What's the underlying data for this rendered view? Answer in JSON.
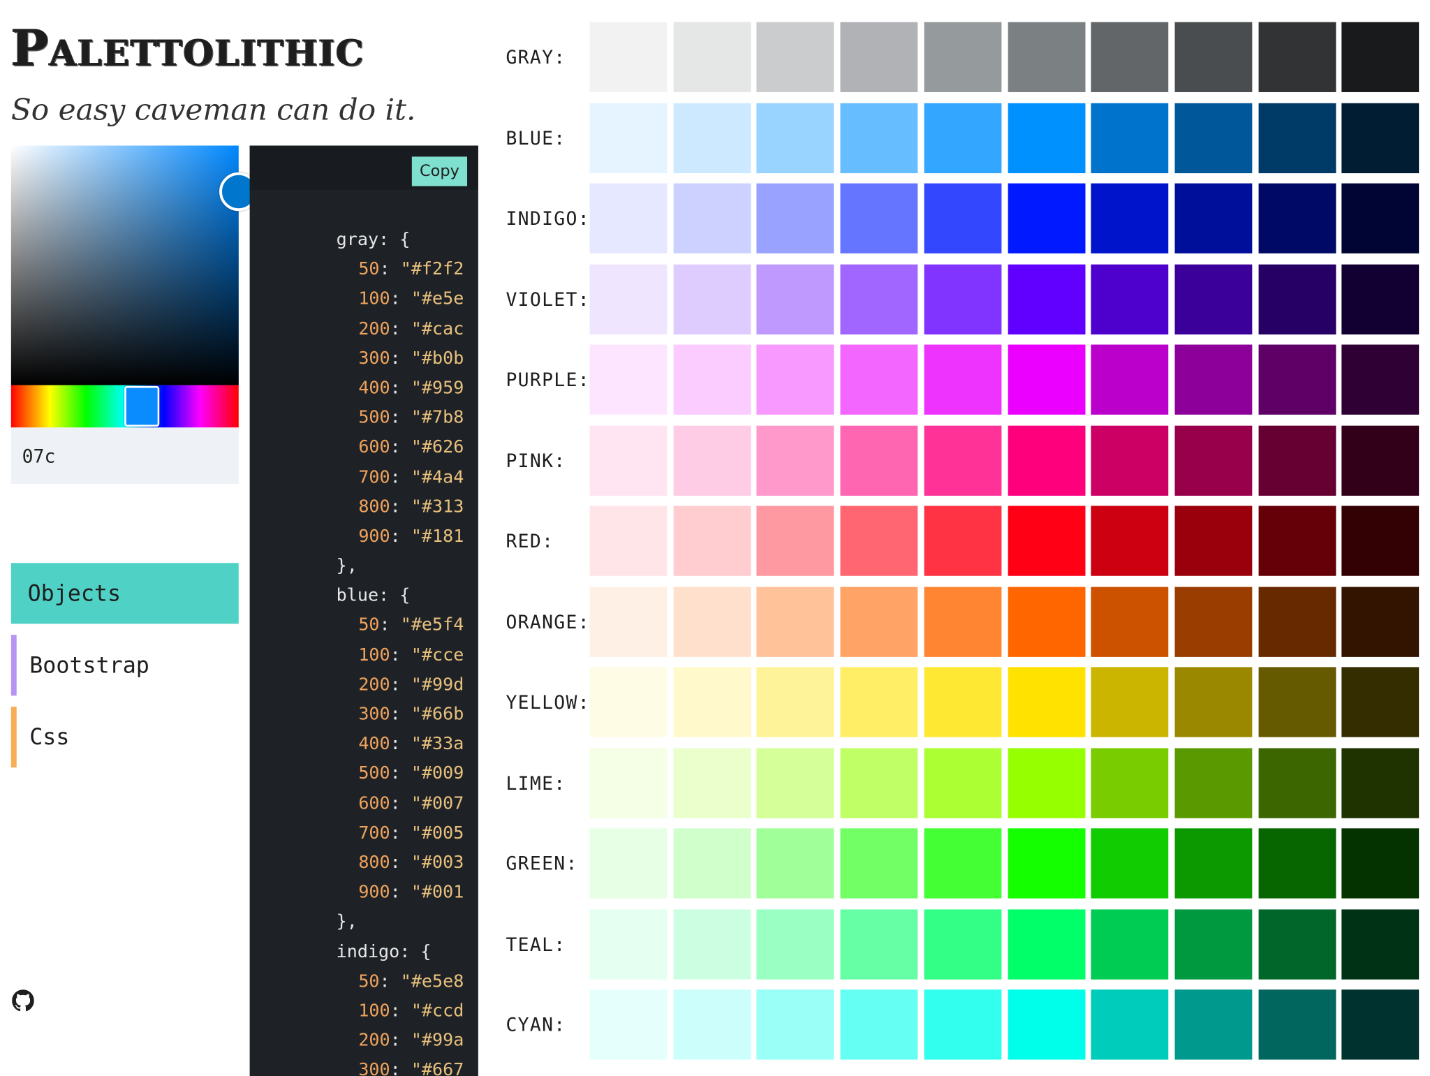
{
  "header": {
    "logo_text": "Palettolithic",
    "tagline": "So easy caveman can do it."
  },
  "picker": {
    "hex_value": "07c",
    "selected_color": "#0077cc",
    "hue_color": "#0088ff"
  },
  "tabs": [
    {
      "label": "Objects",
      "accent": "#4fd1c5",
      "active": true
    },
    {
      "label": "Bootstrap",
      "accent": "#b794f4",
      "active": false
    },
    {
      "label": "Css",
      "accent": "#f6ad55",
      "active": false
    }
  ],
  "code_panel": {
    "copy_label": "Copy",
    "lines": [
      {
        "t": "open",
        "name": "gray"
      },
      {
        "t": "val",
        "k": "50",
        "v": "#f2f2"
      },
      {
        "t": "val",
        "k": "100",
        "v": "#e5e"
      },
      {
        "t": "val",
        "k": "200",
        "v": "#cac"
      },
      {
        "t": "val",
        "k": "300",
        "v": "#b0b"
      },
      {
        "t": "val",
        "k": "400",
        "v": "#959"
      },
      {
        "t": "val",
        "k": "500",
        "v": "#7b8"
      },
      {
        "t": "val",
        "k": "600",
        "v": "#626"
      },
      {
        "t": "val",
        "k": "700",
        "v": "#4a4"
      },
      {
        "t": "val",
        "k": "800",
        "v": "#313"
      },
      {
        "t": "val",
        "k": "900",
        "v": "#181"
      },
      {
        "t": "close"
      },
      {
        "t": "open",
        "name": "blue"
      },
      {
        "t": "val",
        "k": "50",
        "v": "#e5f4"
      },
      {
        "t": "val",
        "k": "100",
        "v": "#cce"
      },
      {
        "t": "val",
        "k": "200",
        "v": "#99d"
      },
      {
        "t": "val",
        "k": "300",
        "v": "#66b"
      },
      {
        "t": "val",
        "k": "400",
        "v": "#33a"
      },
      {
        "t": "val",
        "k": "500",
        "v": "#009"
      },
      {
        "t": "val",
        "k": "600",
        "v": "#007"
      },
      {
        "t": "val",
        "k": "700",
        "v": "#005"
      },
      {
        "t": "val",
        "k": "800",
        "v": "#003"
      },
      {
        "t": "val",
        "k": "900",
        "v": "#001"
      },
      {
        "t": "close"
      },
      {
        "t": "open",
        "name": "indigo"
      },
      {
        "t": "val",
        "k": "50",
        "v": "#e5e8"
      },
      {
        "t": "val",
        "k": "100",
        "v": "#ccd"
      },
      {
        "t": "val",
        "k": "200",
        "v": "#99a"
      },
      {
        "t": "val",
        "k": "300",
        "v": "#667"
      }
    ]
  },
  "palette": [
    {
      "label": "GRAY:",
      "swatches": [
        "#f2f2f2",
        "#e5e6e6",
        "#cacccd",
        "#b0b2b5",
        "#959a9c",
        "#7b8083",
        "#626669",
        "#4a4d4f",
        "#313334",
        "#181a1b"
      ]
    },
    {
      "label": "BLUE:",
      "swatches": [
        "#e5f4ff",
        "#cce9ff",
        "#99d3ff",
        "#66bdff",
        "#33a7ff",
        "#0091ff",
        "#0074cc",
        "#005799",
        "#003a66",
        "#001d33"
      ]
    },
    {
      "label": "INDIGO:",
      "swatches": [
        "#e5e8ff",
        "#ccd1ff",
        "#99a3ff",
        "#6675ff",
        "#3347ff",
        "#0019ff",
        "#0014cc",
        "#000f99",
        "#000a66",
        "#000533"
      ]
    },
    {
      "label": "VIOLET:",
      "swatches": [
        "#efe5ff",
        "#dfccff",
        "#c099ff",
        "#a066ff",
        "#8133ff",
        "#6100ff",
        "#4e00cc",
        "#3a0099",
        "#270066",
        "#130033"
      ]
    },
    {
      "label": "PURPLE:",
      "swatches": [
        "#fde5ff",
        "#fbccff",
        "#f799ff",
        "#f366ff",
        "#ef33ff",
        "#eb00ff",
        "#bc00cc",
        "#8d0099",
        "#5e0066",
        "#2f0033"
      ]
    },
    {
      "label": "PINK:",
      "swatches": [
        "#ffe5f2",
        "#ffcce5",
        "#ff99cb",
        "#ff66b1",
        "#ff3397",
        "#ff007d",
        "#cc0064",
        "#99004b",
        "#660032",
        "#330019"
      ]
    },
    {
      "label": "RED:",
      "swatches": [
        "#ffe5e7",
        "#ffccd0",
        "#ff99a1",
        "#ff6672",
        "#ff3343",
        "#ff0014",
        "#cc0010",
        "#99000c",
        "#660008",
        "#330004"
      ]
    },
    {
      "label": "ORANGE:",
      "swatches": [
        "#fff0e5",
        "#ffe0cc",
        "#ffc299",
        "#ffa366",
        "#ff8533",
        "#ff6600",
        "#cc5200",
        "#993d00",
        "#662900",
        "#331400"
      ]
    },
    {
      "label": "YELLOW:",
      "swatches": [
        "#fffce5",
        "#fff9cc",
        "#fff399",
        "#ffee66",
        "#ffe833",
        "#ffe200",
        "#ccb500",
        "#998800",
        "#665a00",
        "#332d00"
      ]
    },
    {
      "label": "LIME:",
      "swatches": [
        "#f4ffe5",
        "#eaffcc",
        "#d5ff99",
        "#c0ff66",
        "#abff33",
        "#96ff00",
        "#78cc00",
        "#5a9900",
        "#3c6600",
        "#1e3300"
      ]
    },
    {
      "label": "GREEN:",
      "swatches": [
        "#e7ffe5",
        "#d0ffcc",
        "#a1ff99",
        "#72ff66",
        "#43ff33",
        "#14ff00",
        "#10cc00",
        "#0c9900",
        "#086600",
        "#043300"
      ]
    },
    {
      "label": "TEAL:",
      "swatches": [
        "#e5fff0",
        "#ccffe1",
        "#99ffc3",
        "#66ffa5",
        "#33ff87",
        "#00ff69",
        "#00cc54",
        "#00993f",
        "#00662a",
        "#003315"
      ]
    },
    {
      "label": "CYAN:",
      "swatches": [
        "#e5fffd",
        "#ccfffb",
        "#99fff7",
        "#66fff3",
        "#33ffef",
        "#00ffeb",
        "#00ccbc",
        "#00998d",
        "#00665e",
        "#00332f"
      ]
    }
  ]
}
